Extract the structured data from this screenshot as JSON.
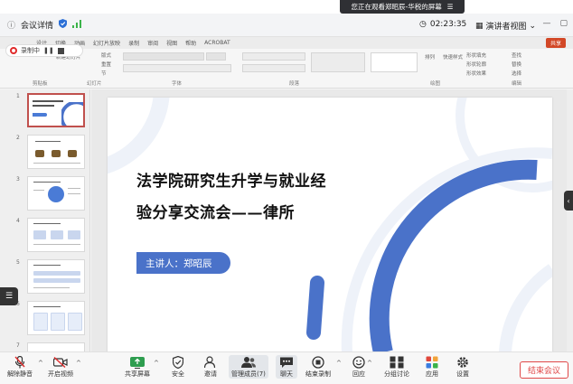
{
  "banner": {
    "text": "您正在观看郑昭辰-华税的屏幕"
  },
  "meeting": {
    "title": "会议详情",
    "timer": "02:23:35",
    "view_mode": "演讲者视图"
  },
  "ppt": {
    "menu": [
      "设计",
      "切换",
      "动画",
      "幻灯片放映",
      "录制",
      "审阅",
      "视图",
      "帮助",
      "ACROBAT"
    ],
    "share_label": "共享",
    "ribbon": {
      "groups": [
        "剪贴板",
        "幻灯片",
        "字体",
        "段落",
        "绘图"
      ],
      "items": [
        "粘贴",
        "新建幻灯片",
        "版式",
        "重置",
        "节",
        "排列",
        "快速样式",
        "形状填充",
        "形状轮廓",
        "形状效果",
        "查找",
        "替换",
        "选择",
        "编辑"
      ]
    },
    "recording": {
      "label": "录制中"
    },
    "thumbnails": [
      {
        "num": "1"
      },
      {
        "num": "2"
      },
      {
        "num": "3"
      },
      {
        "num": "4"
      },
      {
        "num": "5"
      },
      {
        "num": "6"
      },
      {
        "num": "7"
      }
    ],
    "slide": {
      "title_line1": "法学院研究生升学与就业经",
      "title_line2": "验分享交流会——律所",
      "speaker": "主讲人：郑昭辰"
    }
  },
  "toolbar": {
    "mute": "解除静音",
    "video": "开启视频",
    "share": "共享屏幕",
    "security": "安全",
    "invite": "邀请",
    "members": "管理成员(7)",
    "chat": "聊天",
    "record": "结束录制",
    "react": "回应",
    "breakout": "分组讨论",
    "apps": "应用",
    "settings": "设置",
    "end": "结束会议"
  },
  "colors": {
    "accent_blue": "#4a72c9",
    "end_red": "#e04848",
    "share_orange": "#d24726"
  }
}
